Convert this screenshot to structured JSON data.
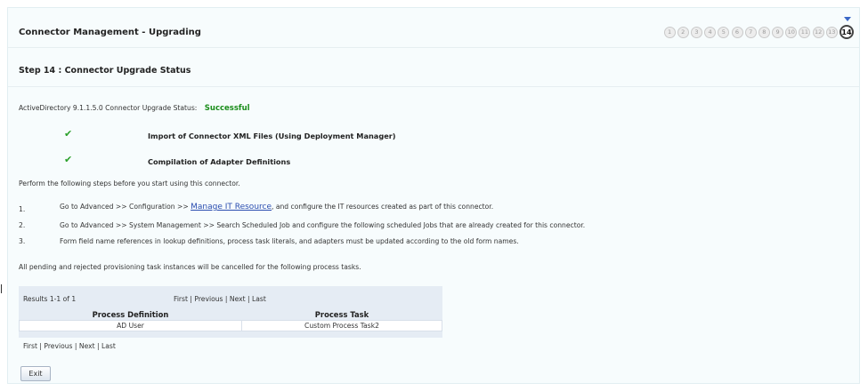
{
  "header": {
    "title": "Connector Management - Upgrading",
    "step_title": "Step 14 : Connector Upgrade Status"
  },
  "wizard": {
    "steps": [
      "1",
      "2",
      "3",
      "4",
      "5",
      "6",
      "7",
      "8",
      "9",
      "10",
      "11",
      "12",
      "13",
      "14"
    ],
    "current": "14"
  },
  "status": {
    "label": "ActiveDirectory 9.1.1.5.0 Connector Upgrade Status:",
    "value": "Successful",
    "color": "#1a8d1a"
  },
  "tasks": [
    {
      "icon": "check-icon",
      "label": "Import of Connector XML Files (Using Deployment Manager)"
    },
    {
      "icon": "check-icon",
      "label": "Compilation of Adapter Definitions"
    }
  ],
  "instructions": {
    "intro": "Perform the following steps before you start using this connector.",
    "steps": [
      {
        "num": "1.",
        "before": "Go to Advanced >> Configuration >> ",
        "link": "Manage IT Resource",
        "after": ", and configure the IT resources created as part of this connector."
      },
      {
        "num": "2.",
        "text": "Go to Advanced >> System Management >> Search Scheduled Job and configure the following scheduled Jobs that are already created for this connector."
      },
      {
        "num": "3.",
        "text": "Form field name references in lookup definitions, process task literals, and adapters must be updated according to the old form names."
      }
    ]
  },
  "pending_note": "All pending and rejected provisioning task instances will be cancelled for the following process tasks.",
  "results": {
    "summary": "Results 1-1 of 1",
    "pager": {
      "first": "First",
      "previous": "Previous",
      "next": "Next",
      "last": "Last",
      "sep": "|"
    },
    "columns": [
      "Process Definition",
      "Process Task"
    ],
    "rows": [
      [
        "AD User",
        "Custom Process Task2"
      ]
    ]
  },
  "actions": {
    "exit": "Exit"
  }
}
